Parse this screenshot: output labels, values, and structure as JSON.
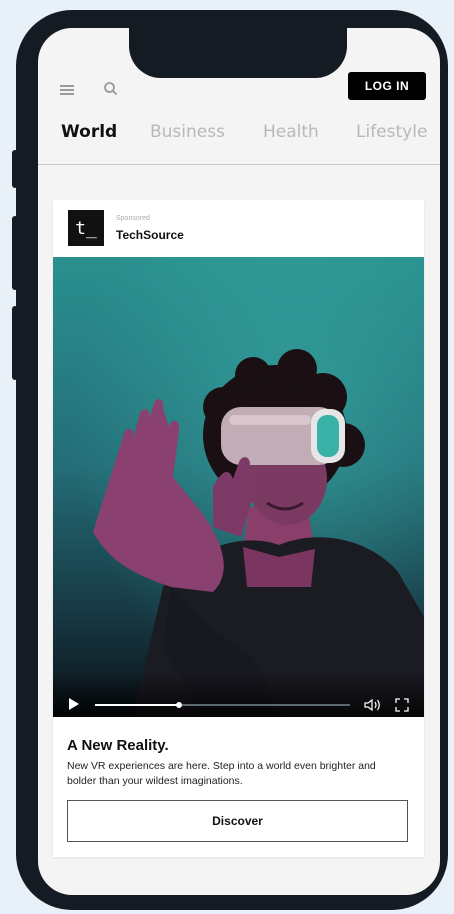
{
  "header": {
    "login_label": "LOG IN"
  },
  "tabs": [
    {
      "label": "World",
      "active": true
    },
    {
      "label": "Business",
      "active": false
    },
    {
      "label": "Health",
      "active": false
    },
    {
      "label": "Lifestyle",
      "active": false
    }
  ],
  "ad": {
    "logo_text": "t_",
    "sponsored_label": "Sponsored",
    "brand": "TechSource",
    "video": {
      "progress": 0.33
    },
    "headline": "A New Reality.",
    "description": "New VR experiences are here. Step into a world even brighter and bolder than your wildest imaginations.",
    "cta_label": "Discover"
  },
  "colors": {
    "accent": "#000000",
    "background": "#e8f1f7",
    "phone_frame": "#141b23"
  },
  "icons": [
    "hamburger-icon",
    "search-icon",
    "play-icon",
    "volume-icon",
    "fullscreen-icon"
  ]
}
